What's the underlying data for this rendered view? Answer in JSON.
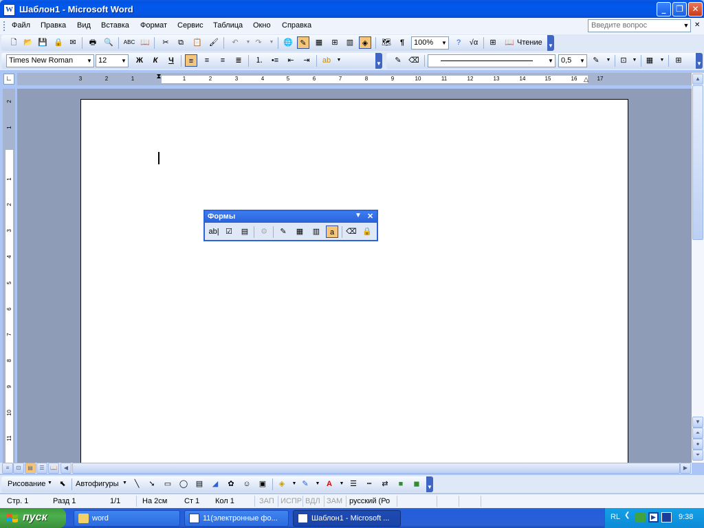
{
  "window": {
    "title": "Шаблон1 - Microsoft Word"
  },
  "menu": {
    "items": [
      "Файл",
      "Правка",
      "Вид",
      "Вставка",
      "Формат",
      "Сервис",
      "Таблица",
      "Окно",
      "Справка"
    ],
    "help_placeholder": "Введите вопрос"
  },
  "toolbar_standard": {
    "zoom": "100%",
    "read_label": "Чтение"
  },
  "toolbar_format": {
    "font": "Times New Roman",
    "size": "12",
    "bold": "Ж",
    "italic": "К",
    "underline": "Ч",
    "line_width": "0,5"
  },
  "ruler": {
    "h_numbers": [
      "3",
      "2",
      "1",
      "1",
      "2",
      "3",
      "4",
      "5",
      "6",
      "7",
      "8",
      "9",
      "10",
      "11",
      "12",
      "13",
      "14",
      "15",
      "16",
      "17"
    ],
    "v_numbers": [
      "2",
      "1",
      "1",
      "2",
      "3",
      "4",
      "5",
      "6",
      "7",
      "8",
      "9",
      "10",
      "11"
    ]
  },
  "forms_toolbar": {
    "title": "Формы",
    "text_field_label": "ab|"
  },
  "drawing_toolbar": {
    "draw_label": "Рисование",
    "autoshapes_label": "Автофигуры"
  },
  "status": {
    "page": "Стр. 1",
    "section": "Разд 1",
    "pages": "1/1",
    "at": "На 2см",
    "line": "Ст 1",
    "col": "Кол 1",
    "rec": "ЗАП",
    "trk": "ИСПР",
    "ext": "ВДЛ",
    "ovr": "ЗАМ",
    "lang": "русский (Ро"
  },
  "taskbar": {
    "start_label": "пуск",
    "tasks": [
      "word",
      "11(электронные фо...",
      "Шаблон1 - Microsoft ..."
    ],
    "lang": "RL",
    "clock": "9:38"
  },
  "colors": {
    "titlebar": "#0453e0",
    "taskbar": "#245edb",
    "start": "#3c9a3c"
  }
}
